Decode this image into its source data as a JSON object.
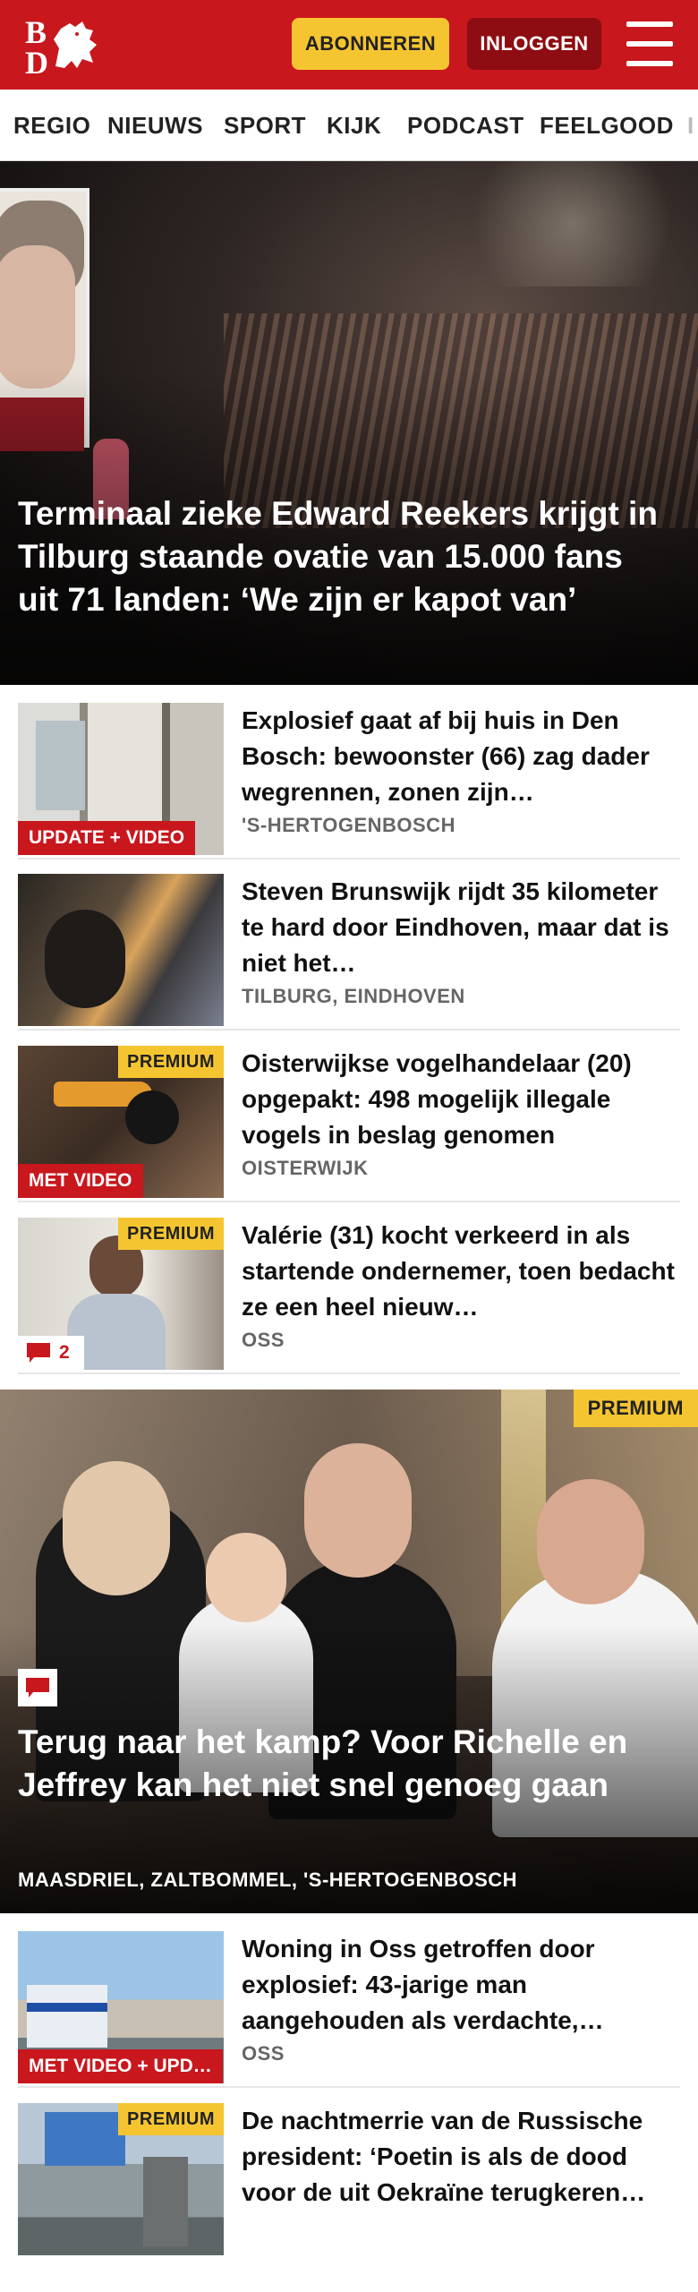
{
  "header": {
    "logo_text": "BD",
    "subscribe_label": "ABONNEREN",
    "login_label": "INLOGGEN",
    "brand_color": "#c8171d",
    "icons": {
      "menu": "hamburger-menu-icon",
      "logo": "bd-dragon-logo"
    }
  },
  "nav": {
    "items": [
      "REGIO",
      "NIEUWS",
      "SPORT",
      "KIJK",
      "PODCAST",
      "FEELGOOD",
      "I"
    ]
  },
  "hero": {
    "title": "Terminaal zieke Edward Reekers krijgt in Tilburg staande ovatie van 15.000 fans uit 71 landen: ‘We zijn er kapot van’"
  },
  "articles": [
    {
      "title": "Explosief gaat af bij huis in Den Bosch: bewoonster (66) zag dader wegrennen, zonen zijn…",
      "location": "'S-HERTOGENBOSCH",
      "tag": "UPDATE + VIDEO"
    },
    {
      "title": "Steven Brunswijk rijdt 35 kilometer te hard door Eindhoven, maar dat is niet het…",
      "location": "TILBURG, EINDHOVEN"
    },
    {
      "title": "Oisterwijkse vogelhandelaar (20) opgepakt: 498 mogelijk illegale vogels in beslag genomen",
      "location": "OISTERWIJK",
      "tag": "MET VIDEO",
      "premium": "PREMIUM"
    },
    {
      "title": "Valérie (31) kocht verkeerd in als startende ondernemer, toen bedacht ze een heel nieuw…",
      "location": "OSS",
      "premium": "PREMIUM",
      "comments": "2"
    }
  ],
  "feature": {
    "premium": "PREMIUM",
    "title": "Terug naar het kamp? Voor Richelle en Jeffrey kan het niet snel genoeg gaan",
    "location": "MAASDRIEL, ZALTBOMMEL, 'S-HERTOGENBOSCH"
  },
  "articles2": [
    {
      "title": "Woning in Oss getroffen door explosief: 43-jarige man aangehouden als verdachte,…",
      "location": "OSS",
      "tag": "MET VIDEO + UPD…"
    },
    {
      "title": "De nachtmerrie van de Russische president: ‘Poetin is als de dood voor de uit Oekraïne terugkeren…",
      "premium": "PREMIUM"
    }
  ]
}
